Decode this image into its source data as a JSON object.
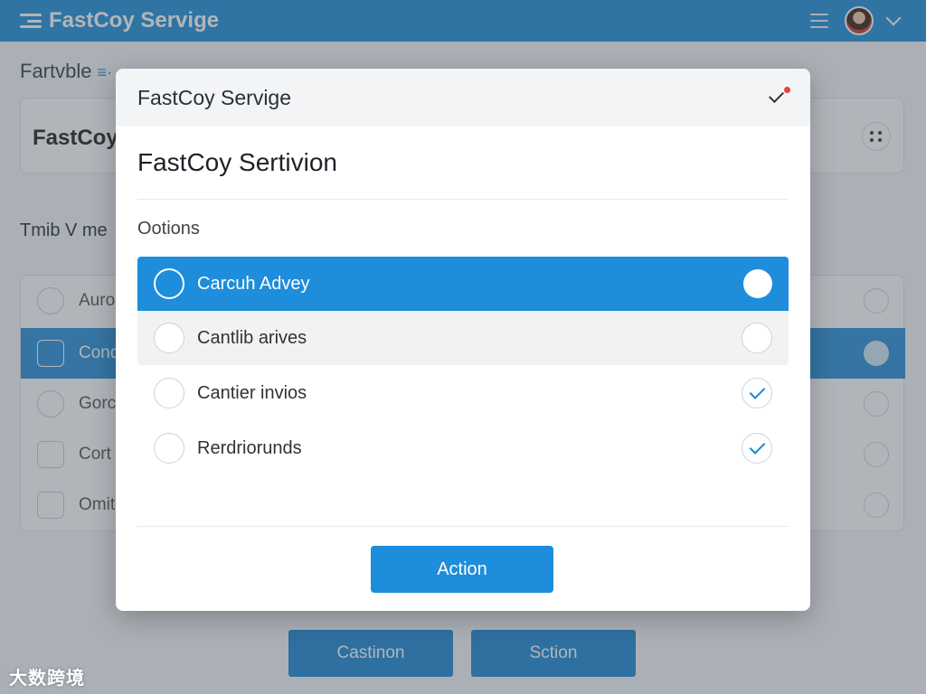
{
  "app": {
    "title": "FastCoy Servige"
  },
  "background": {
    "subtitle": "Fartvble",
    "card_title": "FastCoy",
    "section_label": "Tmib V me",
    "list_items": [
      {
        "label": "Auro",
        "active": false
      },
      {
        "label": "Cond",
        "active": true
      },
      {
        "label": "Gorc",
        "active": false
      },
      {
        "label": "Cort",
        "active": false
      },
      {
        "label": "Omit",
        "active": false
      }
    ],
    "buttons": [
      "Castinon",
      "Sction"
    ]
  },
  "modal": {
    "header_title": "FastCoy Servige",
    "title": "FastCoy Sertivion",
    "options_label": "Ootions",
    "options": [
      {
        "label": "Carcuh Advey",
        "state": "selected"
      },
      {
        "label": "Cantlib arives",
        "state": "hover"
      },
      {
        "label": "Cantier invios",
        "state": "checked"
      },
      {
        "label": "Rerdriorunds",
        "state": "checked"
      }
    ],
    "action_label": "Action"
  },
  "watermark": "大数跨境",
  "colors": {
    "accent": "#1e8ddb",
    "topbar": "#1f8fd8",
    "notification_dot": "#e7443a"
  },
  "icons": {
    "topbar_menu": "menu-icon",
    "topbar_hamburger": "hamburger-icon",
    "header_check": "checkmark-icon",
    "option_check": "checkmark-icon"
  }
}
